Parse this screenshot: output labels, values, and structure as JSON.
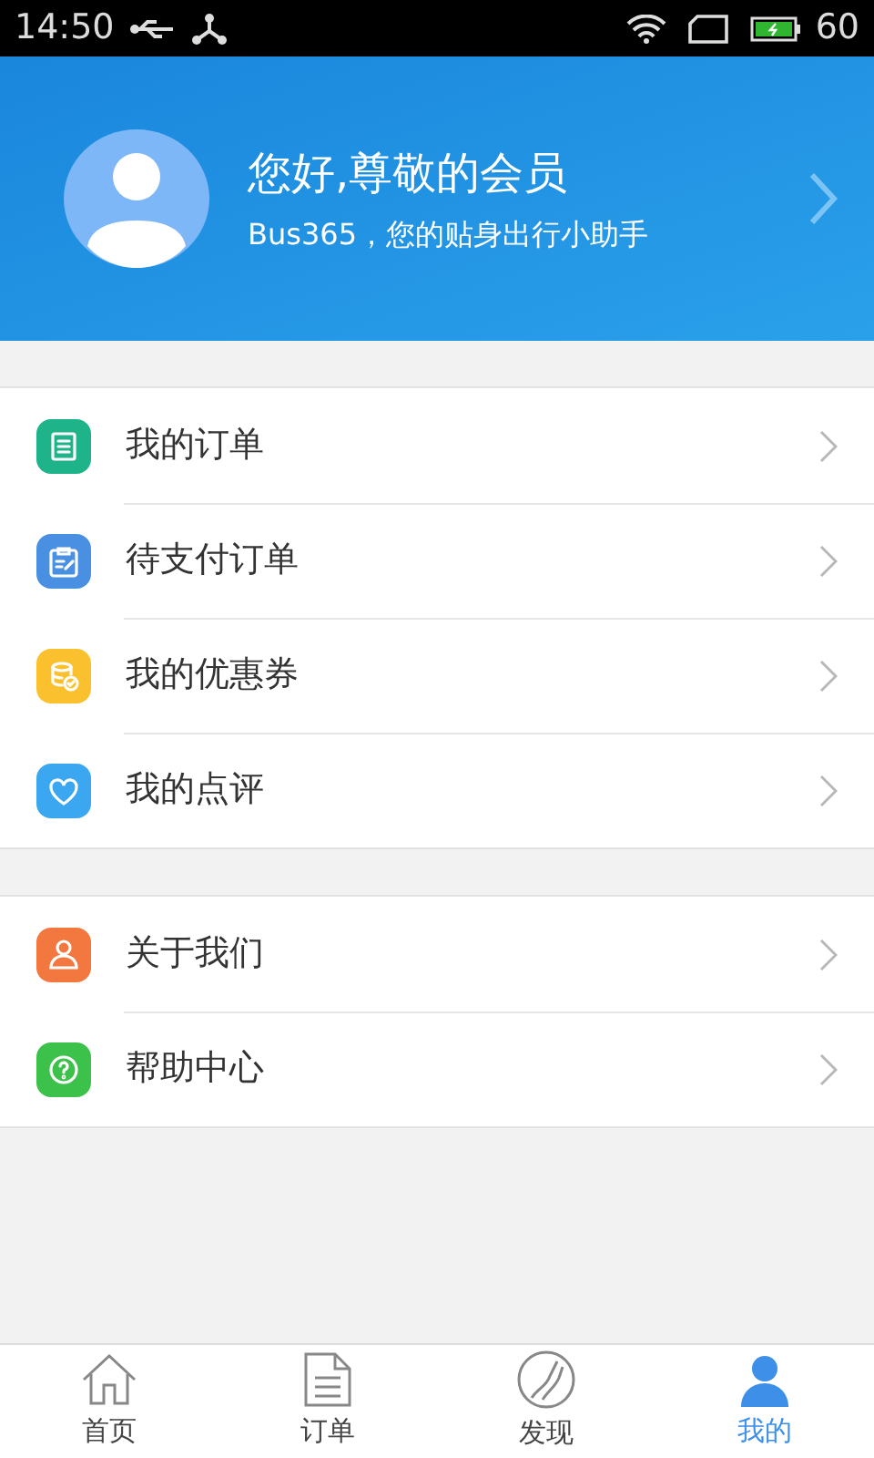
{
  "status_bar": {
    "time": "14:50",
    "battery": "60"
  },
  "profile": {
    "greeting": "您好,尊敬的会员",
    "subtitle": "Bus365，您的贴身出行小助手"
  },
  "menu_groups": [
    {
      "items": [
        {
          "label": "我的订单",
          "kind": "list",
          "color": "#1fb389"
        },
        {
          "label": "待支付订单",
          "kind": "clipboard",
          "color": "#4a90e2"
        },
        {
          "label": "我的优惠券",
          "kind": "coins",
          "color": "#fbc02d"
        },
        {
          "label": "我的点评",
          "kind": "heart",
          "color": "#3aa7f0"
        }
      ]
    },
    {
      "items": [
        {
          "label": "关于我们",
          "kind": "person",
          "color": "#f2783f"
        },
        {
          "label": "帮助中心",
          "kind": "help",
          "color": "#3cc24a"
        }
      ]
    }
  ],
  "tabs": [
    {
      "label": "首页",
      "kind": "home",
      "selected": false
    },
    {
      "label": "订单",
      "kind": "document",
      "selected": false
    },
    {
      "label": "发现",
      "kind": "road",
      "selected": false
    },
    {
      "label": "我的",
      "kind": "person",
      "selected": true
    }
  ]
}
